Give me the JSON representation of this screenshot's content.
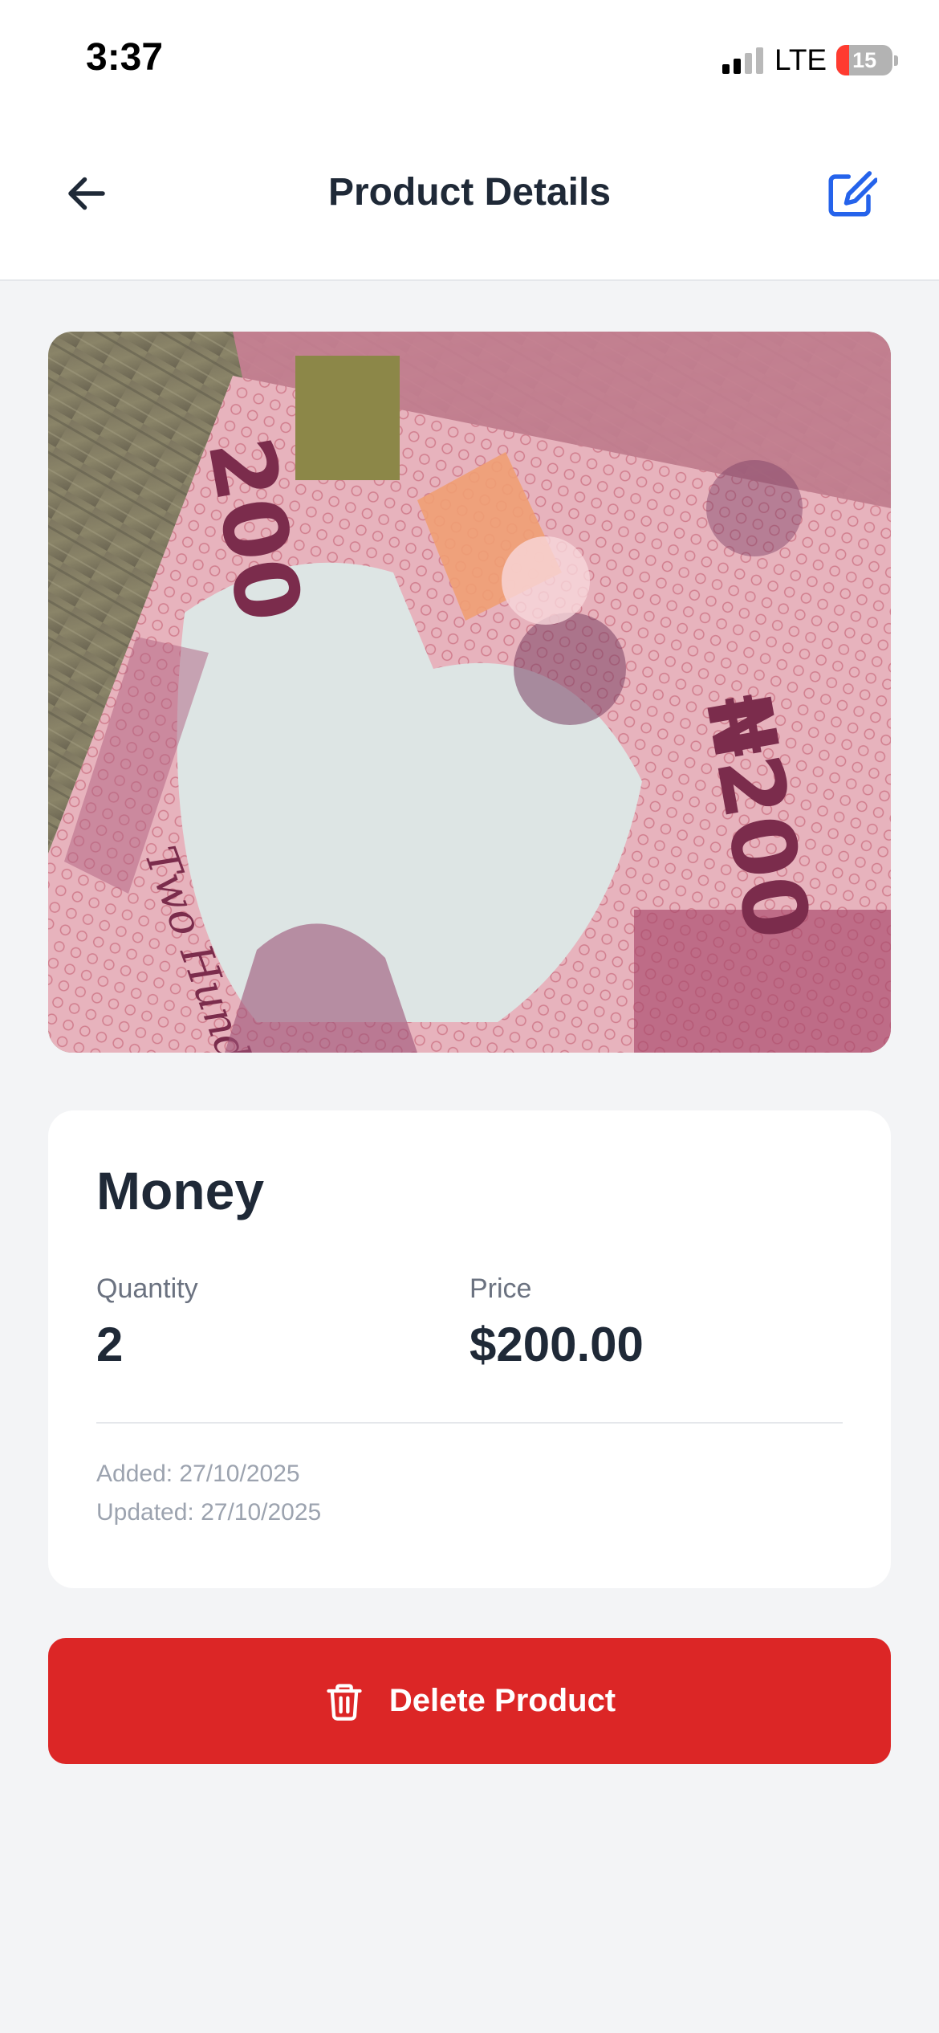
{
  "status_bar": {
    "time": "3:37",
    "network": "LTE",
    "battery_level": "15"
  },
  "header": {
    "title": "Product Details",
    "back_icon": "arrow-left-icon",
    "edit_icon": "edit-icon"
  },
  "product": {
    "image_description_icon": "product-photo",
    "name": "Money",
    "quantity_label": "Quantity",
    "quantity_value": "2",
    "price_label": "Price",
    "price_value": "$200.00",
    "added": "Added: 27/10/2025",
    "updated": "Updated: 27/10/2025"
  },
  "actions": {
    "delete_label": "Delete Product",
    "delete_icon": "trash-icon"
  },
  "colors": {
    "accent": "#2563eb",
    "danger": "#dc2626",
    "text_primary": "#1f2937",
    "text_secondary": "#6b7280",
    "background": "#f3f4f6"
  }
}
